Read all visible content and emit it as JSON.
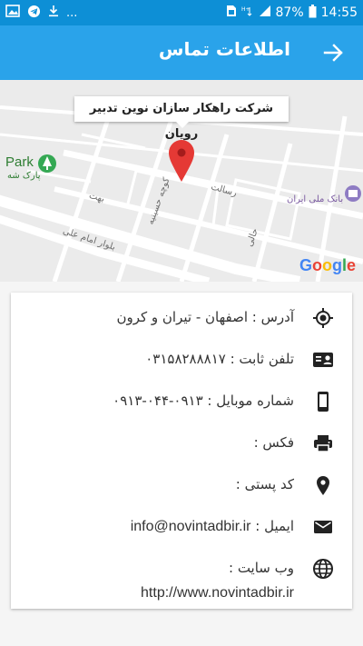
{
  "status_bar": {
    "battery": "87%",
    "time": "14:55",
    "dots": "..."
  },
  "app_bar": {
    "title": "اطلاعات تماس"
  },
  "map": {
    "callout": "شرکت راهکار سازان نوین تدبیر رویان",
    "park_label": "Park",
    "park_sub": "پارک شه",
    "bank_label": "بانک ملی ایران",
    "street_labels": [
      "بلوار امام علی",
      "بهت",
      "کوچه حسینیه",
      "رسالت",
      "حالی"
    ],
    "google": "Google"
  },
  "contact": {
    "address": "آدرس : اصفهان - تیران و کرون",
    "phone": "تلفن ثابت : ۰۳۱۵۸۲۸۸۸۱۷",
    "mobile": "شماره موبایل : ۰۹۱۳-۰۴۴-۰۹۱۳",
    "fax": "فکس :",
    "postal": "کد پستی :",
    "email_label": "ایمیل :",
    "email_value": "info@novintadbir.ir",
    "website_label": "وب سایت :",
    "website_value": "http://www.novintadbir.ir"
  },
  "colors": {
    "status_bar": "#0d8fd6",
    "app_bar": "#2aa3ea",
    "pin": "#e53935"
  }
}
